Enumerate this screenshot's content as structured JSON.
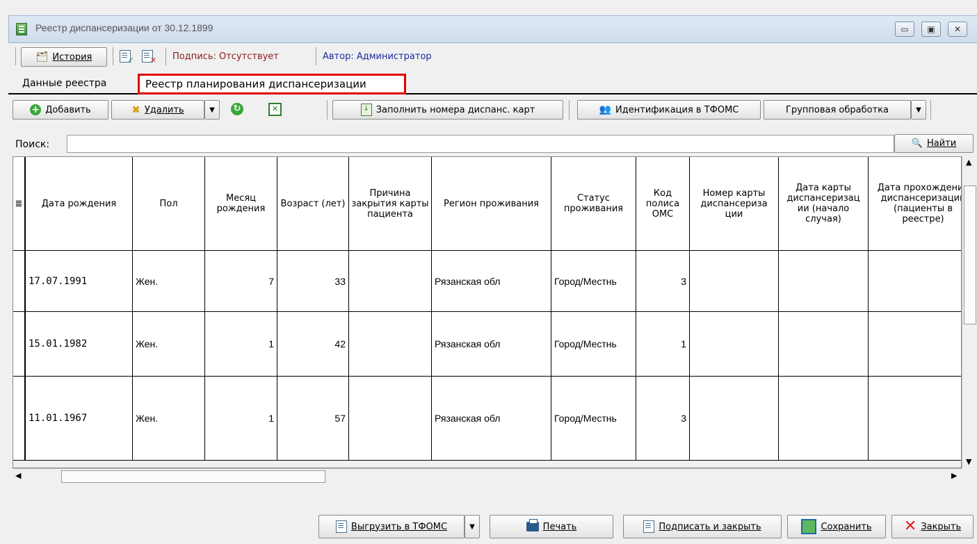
{
  "window": {
    "title": "Реестр диспансеризации  от 30.12.1899",
    "minimize": "▭",
    "maximize": "▣",
    "close": "✕"
  },
  "toolbar1": {
    "history": "История",
    "signature": "Подпись: Отсутствует",
    "author": "Автор: Администратор",
    "signature_color": "#8b1a1a",
    "author_color": "#1a2a9b"
  },
  "tabs": {
    "data": "Данные реестра",
    "plan": "Реестр планирования диспансеризации",
    "highlight_color": "#e00000"
  },
  "toolbar2": {
    "add": "Добавить",
    "delete": "Удалить",
    "fill_cards": "Заполнить номера диспанс. карт",
    "identify": "Идентификация в ТФОМС",
    "group": "Групповая обработка"
  },
  "search": {
    "label": "Поиск:",
    "value": "",
    "find": "Найти"
  },
  "grid": {
    "columns": [
      "Дата рождения",
      "Пол",
      "Месяц рождения",
      "Возраст (лет)",
      "Причина закрытия карты пациента",
      "Регион проживания",
      "Статус проживания",
      "Код полиса ОМС",
      "Номер карты диспансериза ции",
      "Дата карты диспансеризац ии (начало случая)",
      "Дата прохождения диспансеризации (пациенты в реестре)"
    ],
    "rows": [
      [
        "17.07.1991",
        "Жен.",
        "7",
        "33",
        "",
        "Рязанская обл",
        "Город/Местнь",
        "3",
        "",
        "",
        ""
      ],
      [
        "15.01.1982",
        "Жен.",
        "1",
        "42",
        "",
        "Рязанская обл",
        "Город/Местнь",
        "1",
        "",
        "",
        ""
      ],
      [
        "11.01.1967",
        "Жен.",
        "1",
        "57",
        "",
        "Рязанская обл",
        "Город/Местнь",
        "3",
        "",
        "",
        ""
      ]
    ]
  },
  "bottom": {
    "export": "Выгрузить в ТФОМС",
    "print": "Печать",
    "sign_close": "Подписать и закрыть",
    "save": "Сохранить",
    "close": "Закрыть"
  }
}
